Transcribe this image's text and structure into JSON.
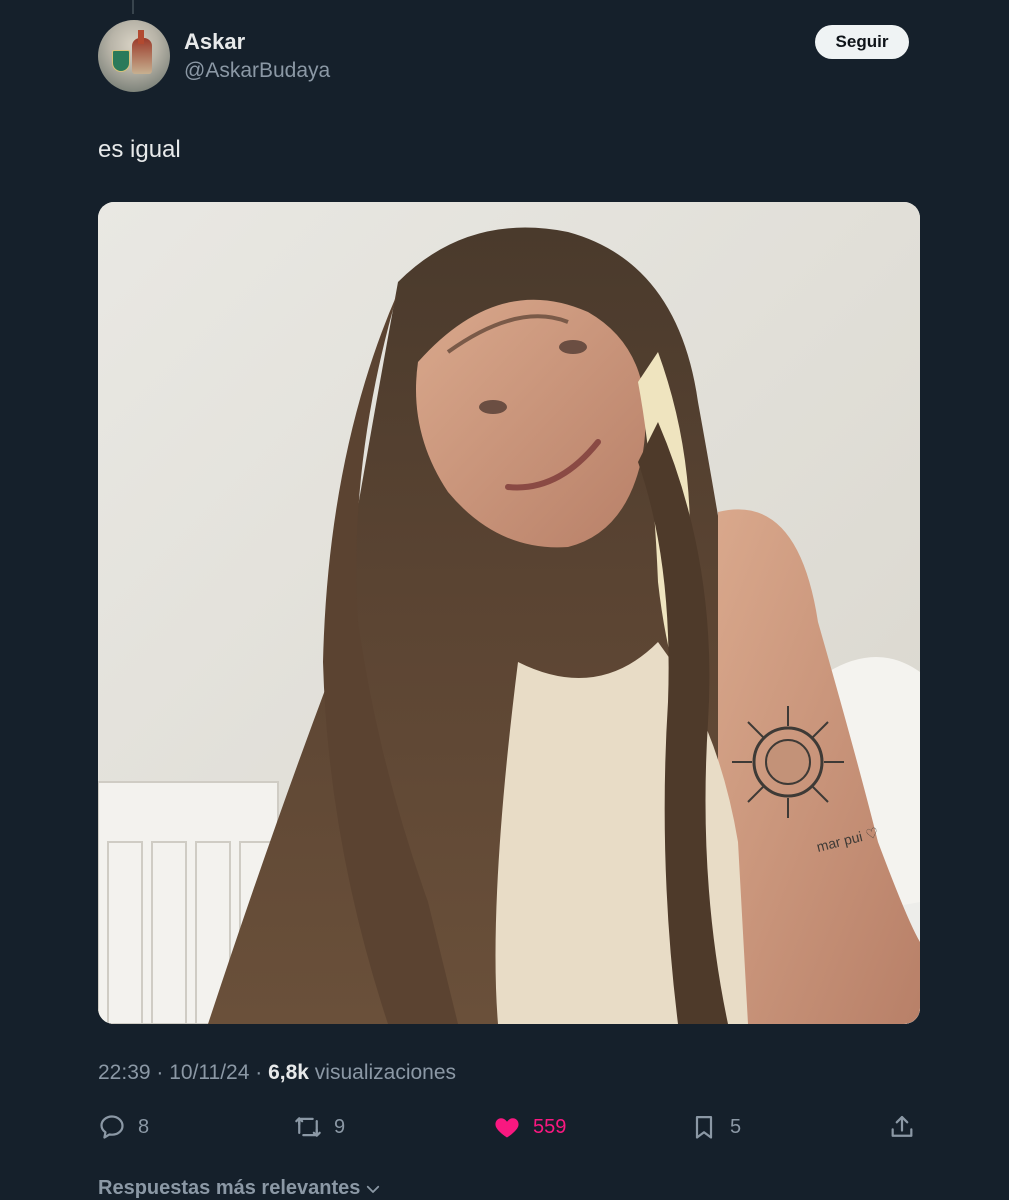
{
  "tweet": {
    "author": {
      "display_name": "Askar",
      "handle": "@AskarBudaya"
    },
    "follow_label": "Seguir",
    "text": "es igual",
    "media": {
      "tattoo_text": "mar pui ♡"
    },
    "meta": {
      "time": "22:39",
      "separator1": " · ",
      "date": "10/11/24",
      "separator2": " · ",
      "views_count": "6,8k",
      "views_label": " visualizaciones"
    },
    "actions": {
      "replies": "8",
      "retweets": "9",
      "likes": "559",
      "bookmarks": "5"
    }
  },
  "replies_sort": {
    "label": "Respuestas más relevantes"
  },
  "icons": {
    "reply": "speech-bubble-icon",
    "retweet": "retweet-icon",
    "like": "heart-icon",
    "bookmark": "bookmark-icon",
    "share": "share-icon",
    "chevron": "chevron-down-icon"
  },
  "colors": {
    "background": "#15202b",
    "text_primary": "#e7e9ea",
    "text_secondary": "#8b98a5",
    "like_active": "#f91880",
    "follow_button_bg": "#eff3f4"
  }
}
